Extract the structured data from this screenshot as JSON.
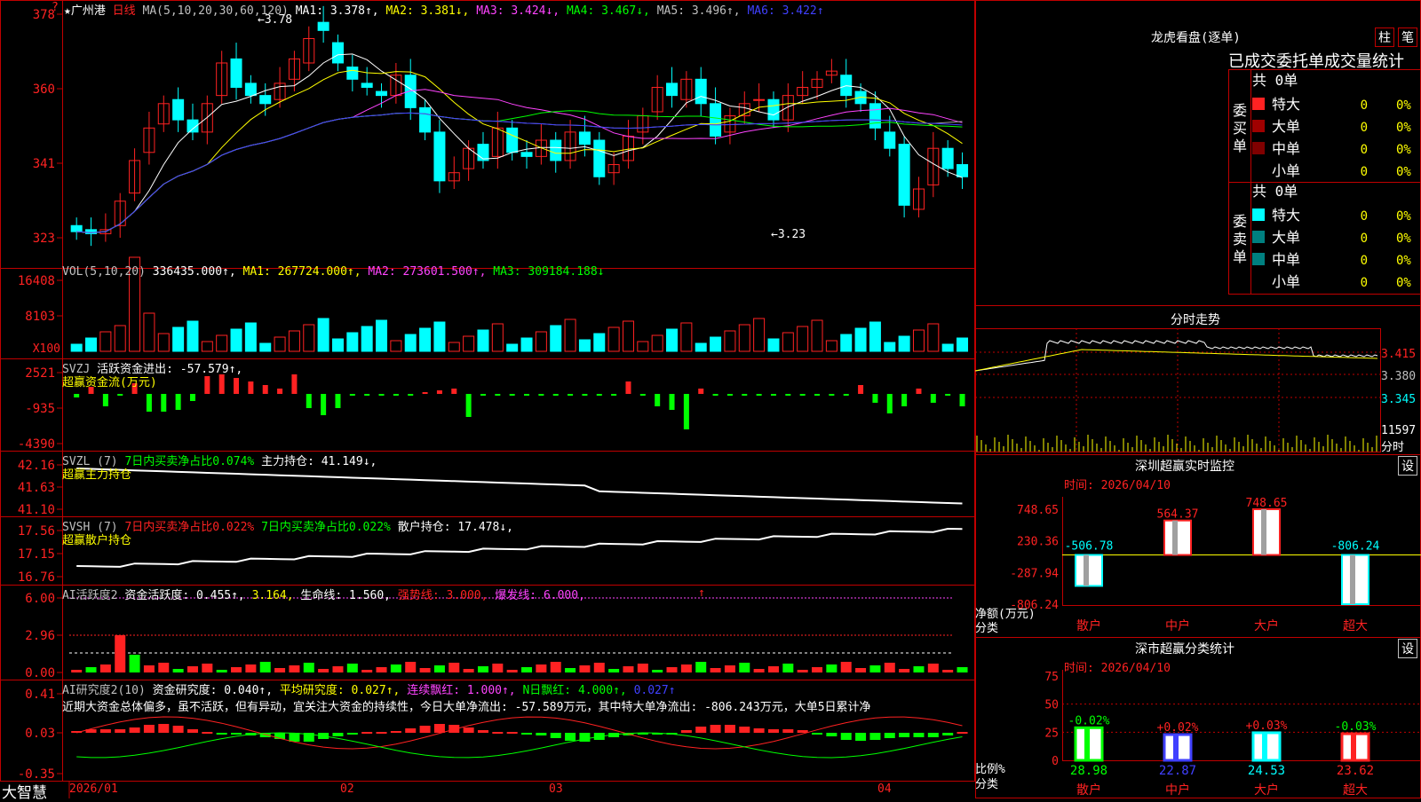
{
  "colors": {
    "up": "#ff2222",
    "down": "#00ffff",
    "grid": "#c00000",
    "white": "#ffffff",
    "yellow": "#ffff00",
    "magenta": "#ff44ff",
    "green": "#00ff00",
    "blue": "#4040ff",
    "gray": "#a0a0a0",
    "teal": "#008080",
    "darkred": "#800000"
  },
  "main": {
    "title_star": "★",
    "stock_name": "广州港",
    "period": "日线",
    "ma_label": "MA(5,10,20,30,60,120)",
    "ma1": "MA1: 3.378↑,",
    "ma2": "MA2: 3.381↓,",
    "ma3": "MA3: 3.424↓,",
    "ma4": "MA4: 3.467↓,",
    "ma5": "MA5: 3.496↑,",
    "ma6": "MA6: 3.422↑",
    "high_mark": "3.78",
    "low_mark": "3.23",
    "corner_q": "?",
    "ticks": [
      "378",
      "360",
      "341",
      "323"
    ]
  },
  "vol": {
    "label": "VOL(5,10,20)",
    "value": "336435.000↑,",
    "ma1": "MA1: 267724.000↑,",
    "ma2": "MA2: 273601.500↑,",
    "ma3": "MA3: 309184.188↓",
    "ticks": [
      "16408",
      "8103"
    ],
    "unit": "X100"
  },
  "svzj": {
    "label": "SVZJ",
    "active": "活跃资金进出: -57.579↑,",
    "sub": "超赢资金流(万元)",
    "ticks": [
      "2521",
      "-935",
      "-4390"
    ]
  },
  "svzl": {
    "label": "SVZL (7)",
    "ratio": "7日内买卖净占比0.074%",
    "hold": "主力持仓: 41.149↓,",
    "sub": "超赢主力持仓",
    "ticks": [
      "42.16",
      "41.63",
      "41.10"
    ]
  },
  "svsh": {
    "label": "SVSH (7)",
    "ratio1": "7日内买卖净占比0.022%",
    "ratio2": "7日内买卖净占比0.022%",
    "hold": "散户持仓: 17.478↓,",
    "sub": "超赢散户持仓",
    "ticks": [
      "17.56",
      "17.15",
      "16.76"
    ]
  },
  "ai1": {
    "label": "AI活跃度2",
    "active": "资金活跃度: 0.455↑,",
    "v2": "3.164,",
    "life": "生命线: 1.560,",
    "strong": "强势线: 3.000,",
    "burst": "爆发线: 6.000,",
    "ticks": [
      "6.00",
      "2.96",
      "0.00"
    ]
  },
  "ai2": {
    "label": "AI研究度2(10)",
    "research": "资金研究度: 0.040↑,",
    "avg": "平均研究度: 0.027↑,",
    "red": "连续飘红: 1.000↑,",
    "nred": "N日飘红: 4.000↑,",
    "last": "0.027↑",
    "comment": "近期大资金总体偏多，虽不活跃，但有异动，宜关注大资金的持续性，今日大单净流出: -57.589万元，其中特大单净流出: -806.243万元，大单5日累计净",
    "ticks": [
      "0.41",
      "0.03",
      "-0.35"
    ]
  },
  "bottom": {
    "brand": "大智慧",
    "dates": [
      "2026/01",
      "02",
      "03",
      "04"
    ]
  },
  "longhu": {
    "title": "龙虎看盘(逐单)",
    "btn1": "柱",
    "btn2": "笔",
    "subtitle": "已成交委托单成交量统计",
    "buy": {
      "head": "委买单",
      "total": "共 0单",
      "rows": [
        {
          "name": "特大",
          "v": "0",
          "p": "0%"
        },
        {
          "name": "大单",
          "v": "0",
          "p": "0%"
        },
        {
          "name": "中单",
          "v": "0",
          "p": "0%"
        },
        {
          "name": "小单",
          "v": "0",
          "p": "0%"
        }
      ]
    },
    "sell": {
      "head": "委卖单",
      "total": "共 0单",
      "rows": [
        {
          "name": "特大",
          "v": "0",
          "p": "0%"
        },
        {
          "name": "大单",
          "v": "0",
          "p": "0%"
        },
        {
          "name": "中单",
          "v": "0",
          "p": "0%"
        },
        {
          "name": "小单",
          "v": "0",
          "p": "0%"
        }
      ]
    }
  },
  "intraday": {
    "title": "分时走势",
    "ticks": [
      "3.415",
      "3.380",
      "3.345"
    ],
    "vol": "11597",
    "unit": "分时"
  },
  "sz_monitor": {
    "title": "深圳超赢实时监控",
    "btn": "设",
    "time": "时间: 2026/04/10",
    "ticks": [
      "748.65",
      "230.36",
      "-287.94",
      "-806.24"
    ],
    "ylabel": "净额(万元)",
    "xlabel": "分类",
    "cats": [
      "散户",
      "中户",
      "大户",
      "超大"
    ],
    "values": [
      "-506.78",
      "564.37",
      "748.65",
      "-806.24"
    ]
  },
  "sz_class": {
    "title": "深市超赢分类统计",
    "btn": "设",
    "time": "时间: 2026/04/10",
    "ticks": [
      "75",
      "50",
      "25",
      "0"
    ],
    "ylabel": "比例%",
    "xlabel": "分类",
    "cats": [
      "散户",
      "中户",
      "大户",
      "超大"
    ],
    "changes": [
      "-0.02%",
      "+0.02%",
      "+0.03%",
      "-0.03%"
    ],
    "values": [
      "28.98",
      "22.87",
      "24.53",
      "23.62"
    ]
  }
}
